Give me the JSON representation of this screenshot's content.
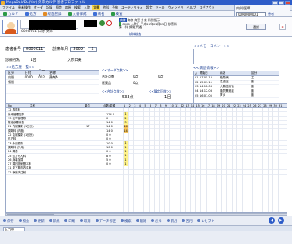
{
  "window": {
    "title": "MegaOak/DL(Ver) 外来カルテ 患者プロファイル"
  },
  "menu": [
    "ファイル",
    "患者操作",
    "オーダ",
    "記録",
    "照会",
    "病棟",
    "検索",
    "入院",
    "文書",
    "他科",
    "予約",
    "ユーティリティ",
    "設定",
    "ツール",
    "ウィンドウ",
    "ヘルプ",
    "ログアウト",
    "入力",
    "機能",
    "連携",
    "画像",
    "保存",
    "操作"
  ],
  "menu_highlight_index": 8,
  "toolbar": [
    "カルテ",
    "処方",
    "経過記録",
    "文書作成",
    "病名",
    "検査"
  ],
  "topright": {
    "user_label": "内科 医師",
    "patient_code": "0000000001",
    "button": "患者"
  },
  "patient": {
    "id": "0000001 日赤 太郎",
    "info_line1": "病棟 病室 外来 科別指示",
    "info_line2": "0000 入院日 平成26年02月05日 診療科",
    "info_line3": "第一科 保険 共通",
    "ward_label": "病棟",
    "select_button": "選択",
    "tab_label": "検体検査"
  },
  "form": {
    "patient_no_label": "患者番号",
    "patient_no": "0000011",
    "period_label": "診療年月",
    "year": "2009",
    "month": "5"
  },
  "form2": {
    "exam_label": "診療行為",
    "count_label": "1回",
    "days_label": "入院日数"
  },
  "section_titles": {
    "left": "<<処方歴一覧>>",
    "mid": "<<オーダ点数>>",
    "memo": "<<メモ・コメント>>",
    "right": "<<病歴情報>>"
  },
  "left_table": {
    "headers": [
      "区分",
      "日付",
      "コード",
      "名称"
    ],
    "rows": [
      [
        "内服",
        "0000",
        "002",
        "薬剤A"
      ],
      [
        "頓服",
        "",
        "",
        ""
      ],
      [
        "",
        "",
        "",
        ""
      ],
      [
        "",
        "",
        "",
        ""
      ],
      [
        "",
        "",
        "",
        ""
      ]
    ]
  },
  "mid_panel": {
    "lbl_total": "合計点数",
    "lbl_med": "医薬品",
    "lbl_proc": "手技料",
    "value_total": "0点",
    "value_med": "0点",
    "value_proc": "0点",
    "sum_label": "<<合計点数>>",
    "sum_value": "533点",
    "count_label": "<<算定回数>>",
    "count_value": "1回"
  },
  "right_table": {
    "headers": [
      "#",
      "開始日",
      "病名",
      "区分"
    ],
    "rows": [
      [
        "01",
        "17.05.10",
        "糖尿病",
        "主"
      ],
      [
        "02",
        "15.09.11",
        "高血圧",
        "副"
      ],
      [
        "03",
        "14.12.03",
        "大腸癌術後",
        "副"
      ],
      [
        "04",
        "14.12.03",
        "脂質異常症",
        "副"
      ],
      [
        "05",
        "16.01.05",
        "胃炎",
        "副"
      ]
    ]
  },
  "grid": {
    "headers": [
      "No",
      "名称",
      "単位",
      "点数/金額"
    ],
    "day_numbers": [
      "1",
      "2",
      "3",
      "4",
      "5",
      "6",
      "7",
      "8",
      "9",
      "10",
      "11",
      "12",
      "13",
      "14",
      "15",
      "16",
      "17",
      "18",
      "19",
      "20",
      "21",
      "22",
      "23",
      "24",
      "25",
      "26",
      "27",
      "28",
      "29",
      "30",
      "31"
    ],
    "rows": [
      {
        "name": "12 再診料",
        "unit": "",
        "pts": "",
        "mark": ""
      },
      {
        "name": "  外来管理加算",
        "unit": "",
        "pts": "124 0",
        "mark": "1"
      },
      {
        "name": "13 医学管理等",
        "unit": "",
        "pts": "0",
        "mark": "2"
      },
      {
        "name": "  特定疾患療養",
        "unit": "",
        "pts": "14 0",
        "mark": "3"
      },
      {
        "name": "21 内服薬剤 (1日分)",
        "unit": "1T",
        "pts": "14 0",
        "mark": "14"
      },
      {
        "name": "  調剤料 (内服)",
        "unit": "",
        "pts": "14 0",
        "mark": "14"
      },
      {
        "name": "22 屯服薬剤 (1回分)",
        "unit": "",
        "pts": "0 0",
        "mark": ""
      },
      {
        "name": "  処方料",
        "unit": "",
        "pts": "0 0",
        "mark": ""
      },
      {
        "name": "23 外用薬剤",
        "unit": "",
        "pts": "10 0",
        "mark": "1"
      },
      {
        "name": "  調剤料 (外用)",
        "unit": "",
        "pts": "10 0",
        "mark": "1"
      },
      {
        "name": "24 調基",
        "unit": "",
        "pts": "0 0",
        "mark": "1"
      },
      {
        "name": "25 処方せん料",
        "unit": "",
        "pts": "8 0",
        "mark": "1"
      },
      {
        "name": "26 麻毒加算",
        "unit": "",
        "pts": "5 0",
        "mark": "1"
      },
      {
        "name": "27 調剤技術基本料",
        "unit": "",
        "pts": "0 0",
        "mark": "1"
      },
      {
        "name": "31 皮下筋肉内注射",
        "unit": "",
        "pts": "",
        "mark": ""
      },
      {
        "name": "32 静脈内注射",
        "unit": "",
        "pts": "",
        "mark": ""
      }
    ]
  },
  "bottom_actions": [
    "保存",
    "照会",
    "更新",
    "新規",
    "印刷",
    "取消",
    "データ修正",
    "検索",
    "削除",
    "戻る",
    "前月",
    "翌月",
    "レセプト"
  ],
  "status_text": "入力中"
}
